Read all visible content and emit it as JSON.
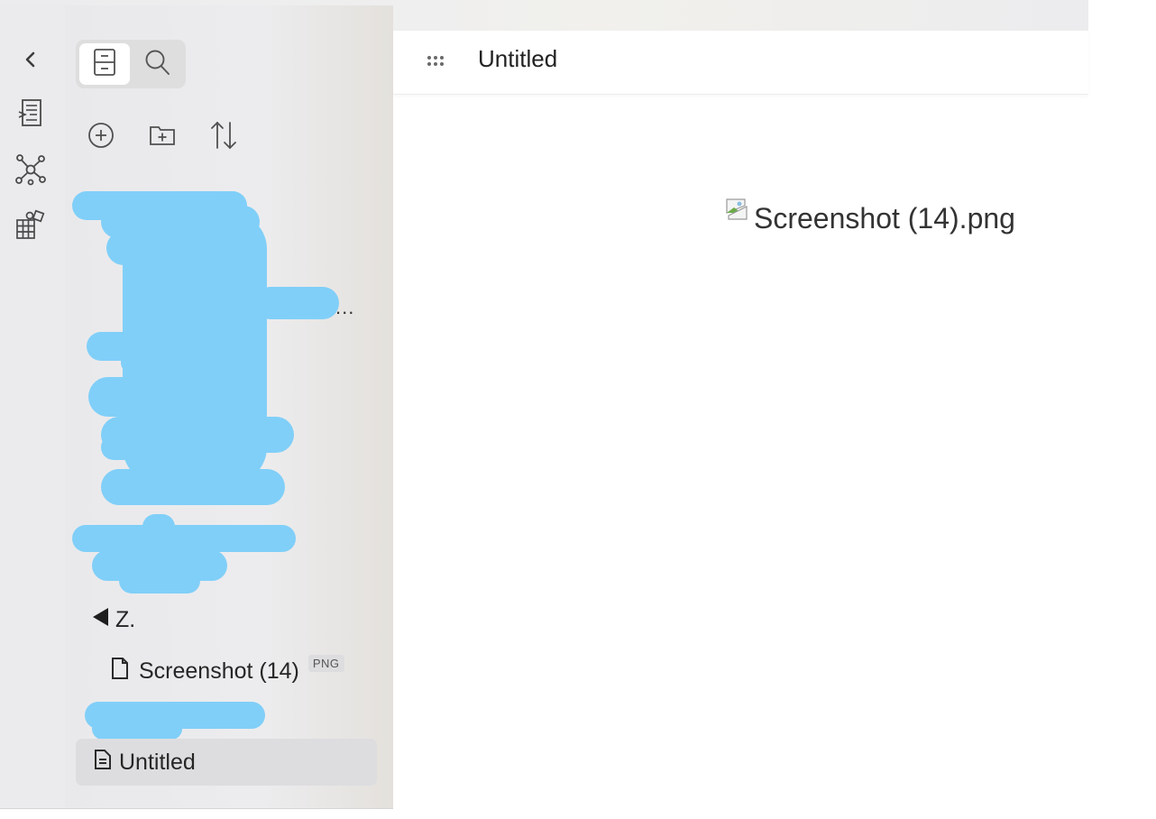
{
  "ribbon": {
    "collapse_icon": "chevron-left-icon",
    "items": [
      "open-quick-switcher-icon",
      "graph-view-icon",
      "canvas-icon"
    ]
  },
  "sidebar": {
    "tabs": [
      {
        "icon": "files-icon",
        "active": true
      },
      {
        "icon": "search-icon",
        "active": false
      }
    ],
    "actions": [
      "new-note-icon",
      "new-folder-icon",
      "sort-icon"
    ],
    "redacted_fragment": "...",
    "tree": {
      "folder_label": "Z.",
      "file_label": "Screenshot (14)",
      "file_badge": "PNG",
      "active_file_label": "Untitled"
    }
  },
  "editor": {
    "header_title": "Untitled",
    "broken_image_alt": "Screenshot (14).png"
  }
}
